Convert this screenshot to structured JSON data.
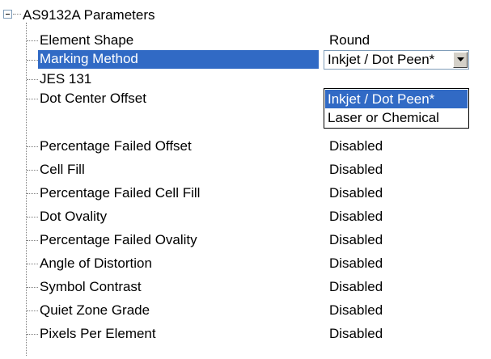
{
  "tree": {
    "root_label": "AS9132A Parameters",
    "properties": [
      {
        "name": "Element Shape",
        "value": "Round"
      },
      {
        "name": "Marking Method",
        "value": "Inkjet / Dot Peen*",
        "selected": true
      },
      {
        "name": "JES 131",
        "value": ""
      },
      {
        "name": "Dot Center Offset",
        "value": ""
      },
      {
        "name": "Percentage Failed Offset",
        "value": "Disabled"
      },
      {
        "name": "Cell Fill",
        "value": "Disabled"
      },
      {
        "name": "Percentage Failed Cell Fill",
        "value": "Disabled"
      },
      {
        "name": "Dot Ovality",
        "value": "Disabled"
      },
      {
        "name": "Percentage Failed Ovality",
        "value": "Disabled"
      },
      {
        "name": "Angle of Distortion",
        "value": "Disabled"
      },
      {
        "name": "Symbol Contrast",
        "value": "Disabled"
      },
      {
        "name": "Quiet Zone Grade",
        "value": "Disabled"
      },
      {
        "name": "Pixels Per Element",
        "value": "Disabled"
      }
    ]
  },
  "combo": {
    "current_value": "Inkjet / Dot Peen*",
    "options": [
      "Inkjet / Dot Peen*",
      "Laser or Chemical"
    ],
    "highlighted_option": "Inkjet / Dot Peen*"
  },
  "colors": {
    "selection": "#316ac5",
    "tree_line": "#808080",
    "button_face": "#d4d0c8"
  },
  "icons": {
    "expander": "minus-box-icon",
    "combo_arrow": "chevron-down-icon"
  }
}
